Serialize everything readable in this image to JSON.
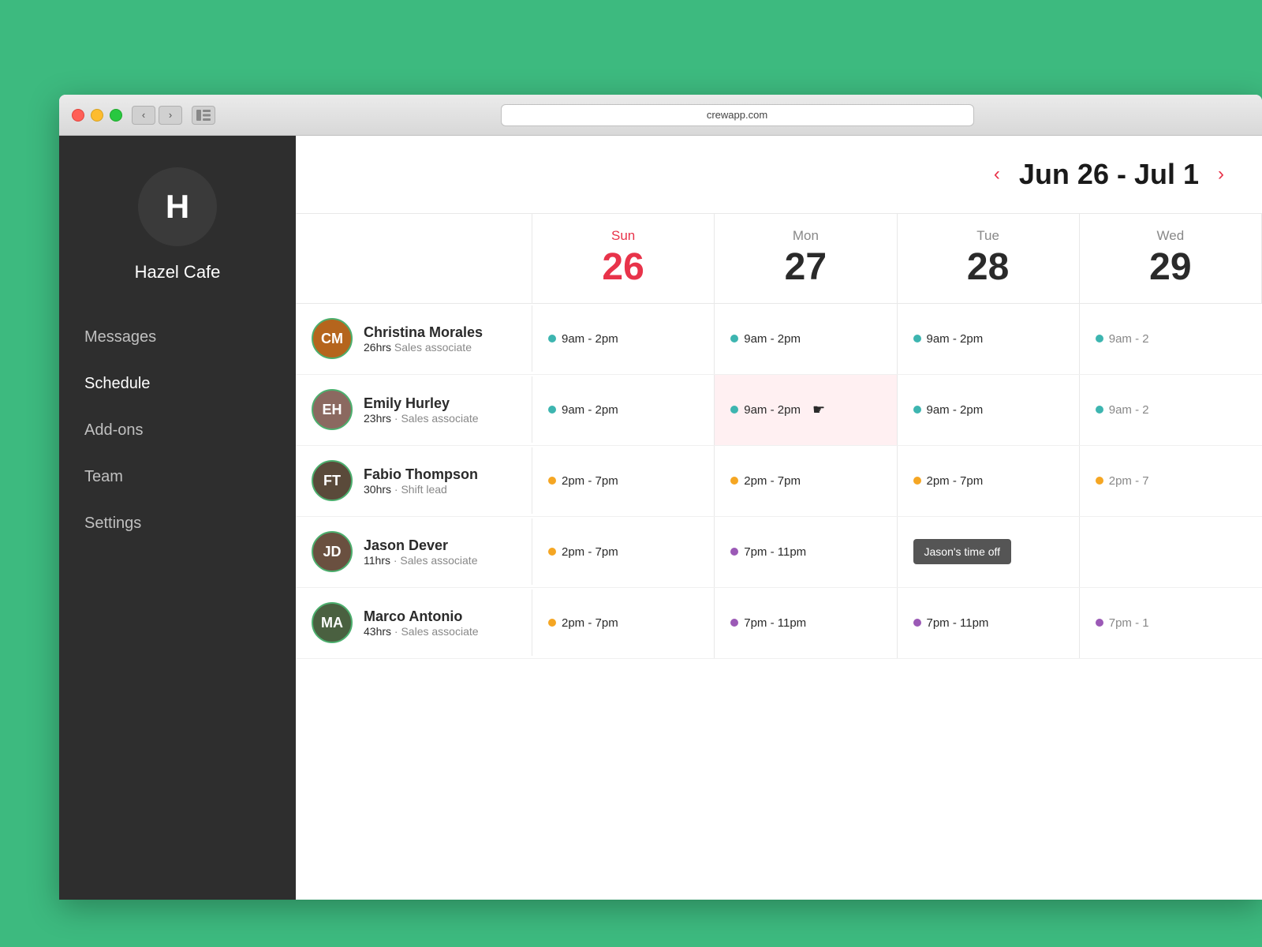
{
  "browser": {
    "url": "crewapp.com"
  },
  "sidebar": {
    "avatar_letter": "H",
    "cafe_name": "Hazel Cafe",
    "nav_items": [
      {
        "id": "messages",
        "label": "Messages"
      },
      {
        "id": "schedule",
        "label": "Schedule"
      },
      {
        "id": "addons",
        "label": "Add-ons"
      },
      {
        "id": "team",
        "label": "Team"
      },
      {
        "id": "settings",
        "label": "Settings"
      }
    ]
  },
  "calendar": {
    "header_title": "Jun 26 - Jul 1",
    "days": [
      {
        "id": "sun",
        "name": "Sun",
        "num": "26",
        "is_today": true
      },
      {
        "id": "mon",
        "name": "Mon",
        "num": "27",
        "is_today": false
      },
      {
        "id": "tue",
        "name": "Tue",
        "num": "28",
        "is_today": false
      },
      {
        "id": "wed",
        "name": "Wed",
        "num": "29",
        "is_today": false
      }
    ],
    "employees": [
      {
        "id": "christina",
        "name": "Christina Morales",
        "hours": "26hrs",
        "role": "Sales associate",
        "avatar_color": "#b5651d",
        "avatar_initials": "CM",
        "border_color": "#4caf6e",
        "shifts": [
          {
            "time": "9am - 2pm",
            "dot": "teal"
          },
          {
            "time": "9am - 2pm",
            "dot": "teal"
          },
          {
            "time": "9am - 2pm",
            "dot": "teal"
          },
          {
            "time": "9am - 2",
            "dot": "teal",
            "truncated": true
          }
        ]
      },
      {
        "id": "emily",
        "name": "Emily Hurley",
        "hours": "23hrs",
        "role": "Sales associate",
        "avatar_color": "#8b6960",
        "avatar_initials": "EH",
        "border_color": "#4caf6e",
        "shifts": [
          {
            "time": "9am - 2pm",
            "dot": "teal"
          },
          {
            "time": "9am - 2pm",
            "dot": "teal",
            "highlighted": true,
            "cursor": true
          },
          {
            "time": "9am - 2pm",
            "dot": "teal"
          },
          {
            "time": "9am - 2",
            "dot": "teal",
            "truncated": true
          }
        ]
      },
      {
        "id": "fabio",
        "name": "Fabio Thompson",
        "hours": "30hrs",
        "role": "Shift lead",
        "avatar_color": "#5a4a3a",
        "avatar_initials": "FT",
        "border_color": "#4caf6e",
        "shifts": [
          {
            "time": "2pm - 7pm",
            "dot": "orange"
          },
          {
            "time": "2pm - 7pm",
            "dot": "orange"
          },
          {
            "time": "2pm - 7pm",
            "dot": "orange"
          },
          {
            "time": "2pm - 7",
            "dot": "orange",
            "truncated": true
          }
        ]
      },
      {
        "id": "jason",
        "name": "Jason Dever",
        "hours": "11hrs",
        "role": "Sales associate",
        "avatar_color": "#6a5040",
        "avatar_initials": "JD",
        "border_color": "#4caf6e",
        "shifts": [
          {
            "time": "2pm - 7pm",
            "dot": "orange"
          },
          {
            "time": "7pm - 11pm",
            "dot": "purple"
          },
          {
            "time": "time_off",
            "label": "Jason's time off"
          },
          {
            "time": "",
            "dot": ""
          }
        ]
      },
      {
        "id": "marco",
        "name": "Marco Antonio",
        "hours": "43hrs",
        "role": "Sales associate",
        "avatar_color": "#4a6040",
        "avatar_initials": "MA",
        "border_color": "#4caf6e",
        "shifts": [
          {
            "time": "2pm - 7pm",
            "dot": "orange"
          },
          {
            "time": "7pm - 11pm",
            "dot": "purple"
          },
          {
            "time": "7pm - 11pm",
            "dot": "purple"
          },
          {
            "time": "7pm - 1",
            "dot": "purple",
            "truncated": true
          }
        ]
      }
    ]
  }
}
